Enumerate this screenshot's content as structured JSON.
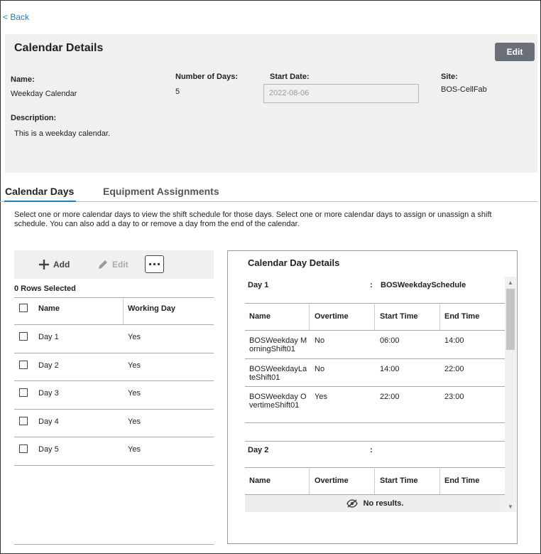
{
  "nav": {
    "back_label": "< Back"
  },
  "details": {
    "title": "Calendar Details",
    "edit_label": "Edit",
    "name_label": "Name:",
    "name_value": "Weekday Calendar",
    "days_label": "Number of Days:",
    "days_value": "5",
    "start_label": "Start Date:",
    "start_value": "2022-08-06",
    "site_label": "Site:",
    "site_value": "BOS-CellFab",
    "description_label": "Description:",
    "description_value": "This is a weekday calendar."
  },
  "tabs": [
    {
      "label": "Calendar Days",
      "active": true
    },
    {
      "label": "Equipment Assignments",
      "active": false
    }
  ],
  "intro_text": "Select one or more calendar days to view the shift schedule for those days. Select one or more calendar days to assign or unassign a shift schedule. You can also add a day to or remove a day from the end of the calendar.",
  "toolbar": {
    "add_label": "Add",
    "edit_label": "Edit",
    "more_icon": "ellipsis-icon"
  },
  "rows_selected": "0 Rows Selected",
  "days_grid": {
    "headers": [
      "Name",
      "Working Day"
    ],
    "rows": [
      {
        "name": "Day 1",
        "working": "Yes"
      },
      {
        "name": "Day 2",
        "working": "Yes"
      },
      {
        "name": "Day 3",
        "working": "Yes"
      },
      {
        "name": "Day 4",
        "working": "Yes"
      },
      {
        "name": "Day 5",
        "working": "Yes"
      }
    ]
  },
  "panel": {
    "title": "Calendar Day Details",
    "colon": ":",
    "day1": {
      "name": "Day 1",
      "schedule": "BOSWeekdaySchedule",
      "headers": [
        "Name",
        "Overtime",
        "Start Time",
        "End Time"
      ],
      "shifts": [
        {
          "name": "BOSWeekday MorningShift01",
          "overtime": "No",
          "start": "06:00",
          "end": "14:00"
        },
        {
          "name": "BOSWeekdayLateShift01",
          "overtime": "No",
          "start": "14:00",
          "end": "22:00"
        },
        {
          "name": "BOSWeekday OvertimeShift01",
          "overtime": "Yes",
          "start": "22:00",
          "end": "23:00"
        }
      ]
    },
    "day2": {
      "name": "Day 2",
      "schedule": "",
      "headers": [
        "Name",
        "Overtime",
        "Start Time",
        "End Time"
      ],
      "no_results": "No results."
    }
  },
  "colors": {
    "link": "#1f7fb8",
    "edit_button": "#6b6f78",
    "panel_bg": "#f0f0f0"
  }
}
